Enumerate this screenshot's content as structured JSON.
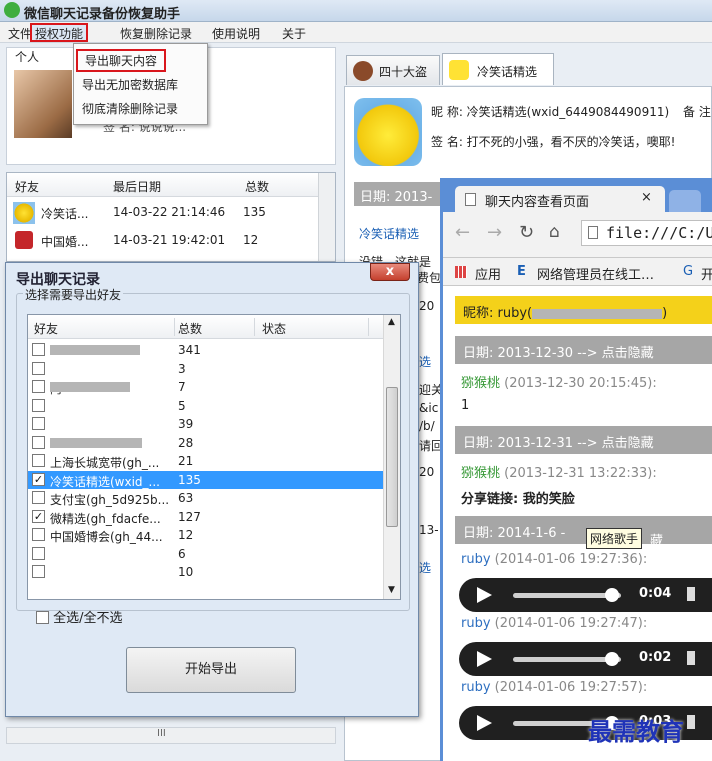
{
  "app": {
    "title": "微信聊天记录备份恢复助手"
  },
  "menu": [
    "文件",
    "授权功能",
    "恢复删除记录",
    "使用说明",
    "关于"
  ],
  "dropdown": [
    "导出聊天内容",
    "导出无加密数据库",
    "彻底清除删除记录"
  ],
  "profile": {
    "label": "个人",
    "signature": "签  名: 说说说..."
  },
  "friend_table": {
    "headers": [
      "好友",
      "最后日期",
      "总数"
    ],
    "rows": [
      {
        "name": "冷笑话...",
        "date": "14-03-22 21:14:46",
        "count": "135"
      },
      {
        "name": "中国婚...",
        "date": "14-03-21 19:42:01",
        "count": "12"
      }
    ]
  },
  "tabs": [
    "四十大盗",
    "冷笑话精选"
  ],
  "chat_info": {
    "nickname": "昵  称: 冷笑话精选(wxid_6449084490911)",
    "note": "备  注",
    "signature": "签  名: 打不死的小强，看不厌的冷笑话，噢耶!",
    "date_label": "日期: 2013-",
    "link_text": "冷笑话精选",
    "fragments": [
      "没错，这就是",
      "费包",
      "20",
      "选",
      "迎关",
      "&ic",
      "/b/",
      "请回",
      "20",
      "13-",
      "选"
    ]
  },
  "dialog": {
    "title": "导出聊天记录",
    "close": "x",
    "group_label": "选择需要导出好友",
    "headers": [
      "好友",
      "总数",
      "状态"
    ],
    "rows": [
      {
        "name": "8...",
        "count": "341",
        "checked": false
      },
      {
        "name": "",
        "count": "3",
        "checked": false
      },
      {
        "name": "阿",
        "count": "7",
        "checked": false
      },
      {
        "name": "",
        "count": "5",
        "checked": false
      },
      {
        "name": "",
        "count": "39",
        "checked": false
      },
      {
        "name": "s...",
        "count": "28",
        "checked": false
      },
      {
        "name": "上海长城宽带(gh_...",
        "count": "21",
        "checked": false
      },
      {
        "name": "冷笑话精选(wxid_...",
        "count": "135",
        "checked": true,
        "selected": true
      },
      {
        "name": "支付宝(gh_5d925b...",
        "count": "63",
        "checked": false
      },
      {
        "name": "微精选(gh_fdacfe...",
        "count": "127",
        "checked": true
      },
      {
        "name": "中国婚博会(gh_44...",
        "count": "12",
        "checked": false
      },
      {
        "name": "",
        "count": "6",
        "checked": false
      },
      {
        "name": "",
        "count": "10",
        "checked": false
      }
    ],
    "select_all": "全选/全不选",
    "start": "开始导出"
  },
  "browser": {
    "tab_title": "聊天内容查看页面",
    "tab_close": "×",
    "url": "file:///C:/U",
    "bookmarks": [
      "应用",
      "网络管理员在线工…",
      "开"
    ],
    "nickname": "昵称: ruby(",
    "nickname_end": ")",
    "messages": [
      {
        "type": "date",
        "text": "日期: 2013-12-30  --> 点击隐藏"
      },
      {
        "type": "sender",
        "name": "猕猴桃",
        "time": " (2013-12-30 20:15:45):"
      },
      {
        "type": "text",
        "text": "1"
      },
      {
        "type": "date",
        "text": "日期: 2013-12-31  --> 点击隐藏"
      },
      {
        "type": "sender",
        "name": "猕猴桃",
        "time": " (2013-12-31 13:22:33):"
      },
      {
        "type": "text",
        "text": "分享链接: 我的笑脸"
      },
      {
        "type": "date",
        "text": "日期: 2014-1-6  -"
      },
      {
        "type": "sender",
        "name": "ruby",
        "time": " (2014-01-06 19:27:36):"
      },
      {
        "type": "audio",
        "time": "0:04"
      },
      {
        "type": "sender",
        "name": "ruby",
        "time": " (2014-01-06 19:27:47):"
      },
      {
        "type": "audio",
        "time": "0:02"
      },
      {
        "type": "sender",
        "name": "ruby",
        "time": " (2014-01-06 19:27:57):"
      },
      {
        "type": "audio",
        "time": "0:03"
      }
    ],
    "tooltip": "网络歌手",
    "tooltip_suffix": "藏"
  },
  "watermark": "最需教育",
  "colors": {
    "highlight": "#d9161c",
    "selection": "#3399ff",
    "nickbar": "#f4d11a"
  }
}
